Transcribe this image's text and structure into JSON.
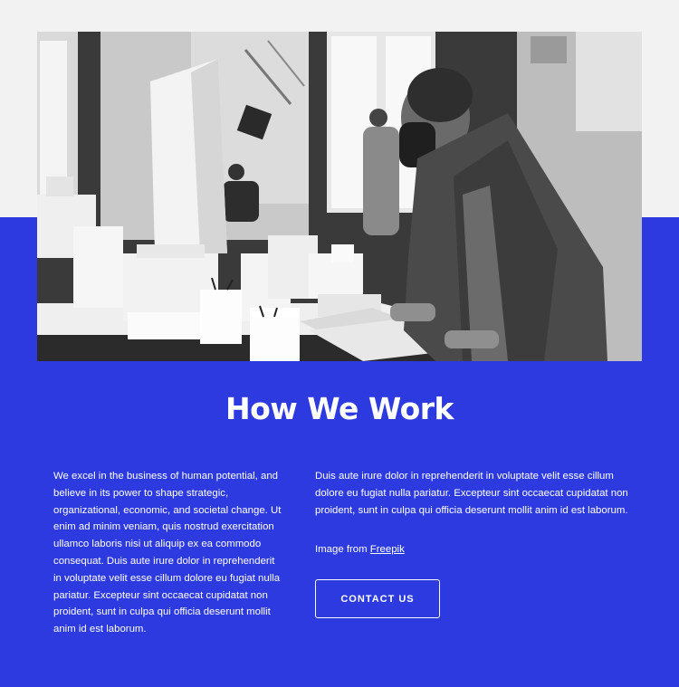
{
  "hero": {
    "image_icon": "architecture-office-photo",
    "colors": {
      "page_top": "#f2f2f2",
      "accent_blue": "#2d3ae0"
    }
  },
  "section": {
    "title": "How We Work",
    "left_paragraph": "We excel in the business of human potential, and believe in its power to shape strategic, organizational, economic, and societal change. Ut enim ad minim veniam, quis nostrud exercitation ullamco laboris nisi ut aliquip ex ea commodo consequat. Duis aute irure dolor in reprehenderit in voluptate velit esse cillum dolore eu fugiat nulla pariatur. Excepteur sint occaecat cupidatat non proident, sunt in culpa qui officia deserunt mollit anim id est laborum.",
    "right_paragraph": "Duis aute irure dolor in reprehenderit in voluptate velit esse cillum dolore eu fugiat nulla pariatur. Excepteur sint occaecat cupidatat non proident, sunt in culpa qui officia deserunt mollit anim id est laborum.",
    "credit_prefix": "Image from ",
    "credit_link": "Freepik",
    "contact_button": "CONTACT US"
  }
}
